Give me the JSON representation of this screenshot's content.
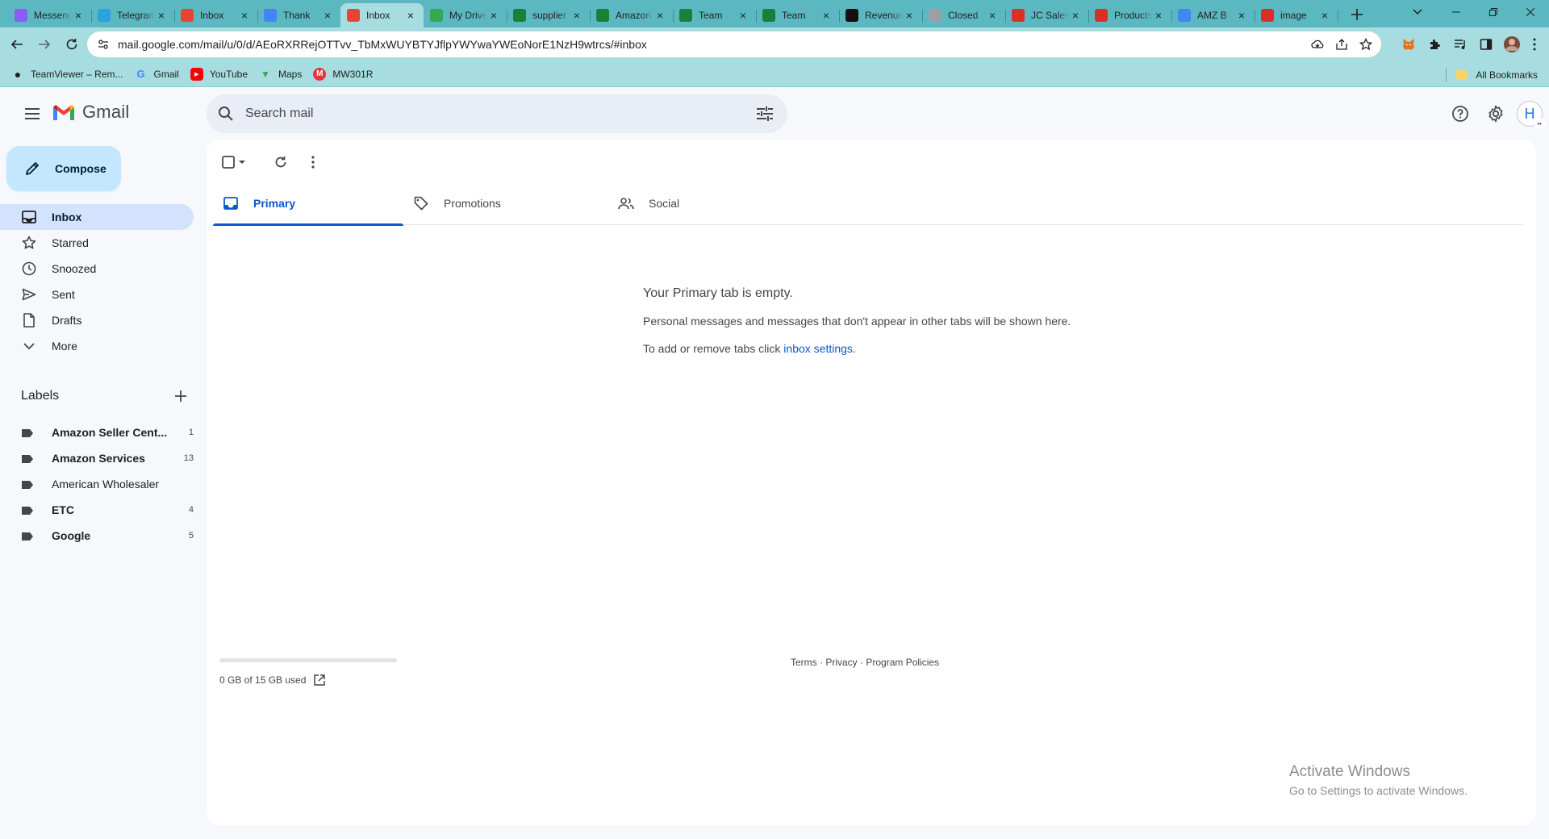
{
  "browser": {
    "tabs": [
      {
        "title": "Messenger",
        "icon": "messenger-icon",
        "color": "#8b5cf6"
      },
      {
        "title": "Telegram",
        "icon": "telegram-icon",
        "color": "#2aa3df"
      },
      {
        "title": "Inbox",
        "icon": "gmail-icon",
        "color": "#ea4335"
      },
      {
        "title": "Thank",
        "icon": "pencil-icon",
        "color": "#4285f4"
      },
      {
        "title": "Inbox",
        "icon": "gmail-icon",
        "color": "#ea4335",
        "active": true
      },
      {
        "title": "My Drive",
        "icon": "drive-icon",
        "color": "#34a853"
      },
      {
        "title": "supplier",
        "icon": "sheets-icon",
        "color": "#188038"
      },
      {
        "title": "Amazon",
        "icon": "sheets-icon",
        "color": "#188038"
      },
      {
        "title": "Team",
        "icon": "sheets-icon",
        "color": "#188038"
      },
      {
        "title": "Team",
        "icon": "sheets-icon",
        "color": "#188038"
      },
      {
        "title": "Revenue",
        "icon": "amazon-icon",
        "color": "#111111"
      },
      {
        "title": "Closed",
        "icon": "doc-icon",
        "color": "#9aa0a6"
      },
      {
        "title": "JC Sales",
        "icon": "jc-icon",
        "color": "#d93025"
      },
      {
        "title": "Products",
        "icon": "jc-icon",
        "color": "#d93025"
      },
      {
        "title": "AMZ B",
        "icon": "pencil-icon",
        "color": "#4285f4"
      },
      {
        "title": "image",
        "icon": "v-icon",
        "color": "#d93025"
      }
    ],
    "url": "mail.google.com/mail/u/0/d/AEoRXRRejOTTvv_TbMxWUYBTYJflpYWYwaYWEoNorE1NzH9wtrcs/#inbox",
    "bookmarks": [
      {
        "label": "TeamViewer – Rem...",
        "icon": "teamviewer-icon"
      },
      {
        "label": "Gmail",
        "icon": "google-icon"
      },
      {
        "label": "YouTube",
        "icon": "youtube-icon"
      },
      {
        "label": "Maps",
        "icon": "maps-icon"
      },
      {
        "label": "MW301R",
        "icon": "mercusys-icon"
      }
    ],
    "all_bookmarks": "All Bookmarks"
  },
  "gmail": {
    "product_name": "Gmail",
    "search_placeholder": "Search mail",
    "avatar_letter": "H",
    "compose_label": "Compose",
    "nav": [
      {
        "label": "Inbox",
        "icon": "inbox-icon",
        "active": true
      },
      {
        "label": "Starred",
        "icon": "star-icon"
      },
      {
        "label": "Snoozed",
        "icon": "clock-icon"
      },
      {
        "label": "Sent",
        "icon": "send-icon"
      },
      {
        "label": "Drafts",
        "icon": "draft-icon"
      },
      {
        "label": "More",
        "icon": "chevron-down-icon"
      }
    ],
    "labels_title": "Labels",
    "labels": [
      {
        "name": "Amazon Seller Cent...",
        "count": "1",
        "bold": true
      },
      {
        "name": "Amazon Services",
        "count": "13",
        "bold": true
      },
      {
        "name": "American Wholesaler",
        "count": "",
        "bold": false
      },
      {
        "name": "ETC",
        "count": "4",
        "bold": true
      },
      {
        "name": "Google",
        "count": "5",
        "bold": true
      }
    ],
    "category_tabs": [
      {
        "label": "Primary",
        "icon": "inbox-tab-icon",
        "active": true
      },
      {
        "label": "Promotions",
        "icon": "tag-icon"
      },
      {
        "label": "Social",
        "icon": "people-icon"
      }
    ],
    "empty_state": {
      "heading": "Your Primary tab is empty.",
      "line1": "Personal messages and messages that don't appear in other tabs will be shown here.",
      "line2_prefix": "To add or remove tabs click ",
      "line2_link": "inbox settings",
      "line2_suffix": "."
    },
    "storage": {
      "text": "0 GB of 15 GB used",
      "used_fraction": 0
    },
    "footer": {
      "terms": "Terms",
      "privacy": "Privacy",
      "policies": "Program Policies",
      "sep": " · "
    }
  },
  "windows_watermark": {
    "line1": "Activate Windows",
    "line2": "Go to Settings to activate Windows."
  }
}
